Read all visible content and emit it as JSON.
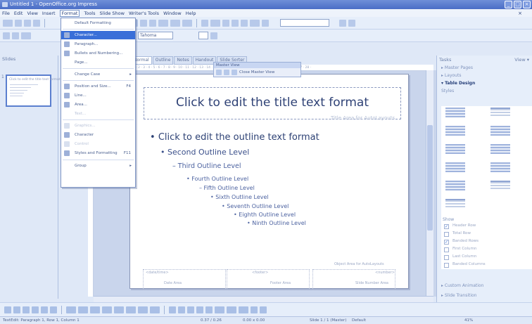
{
  "window": {
    "title": "Untitled 1 - OpenOffice.org Impress",
    "controls": [
      "_",
      "□",
      "×"
    ]
  },
  "menubar": {
    "items": [
      "File",
      "Edit",
      "View",
      "Insert",
      "Format",
      "Tools",
      "Slide Show",
      "Writer's Tools",
      "Window",
      "Help"
    ],
    "close_doc": "×"
  },
  "format_menu": {
    "items": [
      {
        "label": "Default Formatting",
        "shortcut": "",
        "state": "normal"
      },
      {
        "label": "Character...",
        "shortcut": "",
        "state": "highlighted"
      },
      {
        "label": "Paragraph...",
        "shortcut": "",
        "state": "normal"
      },
      {
        "label": "Bullets and Numbering...",
        "shortcut": "",
        "state": "normal"
      },
      {
        "label": "Page...",
        "shortcut": "",
        "state": "normal"
      },
      {
        "label": "Change Case",
        "shortcut": "",
        "state": "submenu"
      },
      {
        "label": "Position and Size...",
        "shortcut": "F4",
        "state": "normal"
      },
      {
        "label": "Line...",
        "shortcut": "",
        "state": "normal"
      },
      {
        "label": "Area...",
        "shortcut": "",
        "state": "normal"
      },
      {
        "label": "Text...",
        "shortcut": "",
        "state": "disabled"
      },
      {
        "label": "Graphics...",
        "shortcut": "",
        "state": "disabled"
      },
      {
        "label": "Character",
        "shortcut": "",
        "state": "normal"
      },
      {
        "label": "Control",
        "shortcut": "",
        "state": "disabled"
      },
      {
        "label": "Styles and Formatting",
        "shortcut": "F11",
        "state": "normal"
      },
      {
        "label": "Group",
        "shortcut": "",
        "state": "submenu"
      }
    ]
  },
  "formatting_bar": {
    "font_name": "Tahoma",
    "font_size": "",
    "style": ""
  },
  "slides_panel": {
    "header": "Slides",
    "thumb_number": "1",
    "thumb_title": "Click to edit the title text format"
  },
  "view_tabs": [
    "Normal",
    "Outline",
    "Notes",
    "Handout",
    "Slide Sorter"
  ],
  "master_view_toolbar": {
    "title": "Master View",
    "close_label": "Close Master View"
  },
  "ruler_ticks": "· 1 · 2 · 3 · 4 · 5 · 6 · 7 · 8 · 9 · 10 · 11 · 12 · 13 · 14 · 15 · 16 · 17 · 18 · 19 · 20 · 21 · 22 · 23 · 24 · 25 · 26 · 27 · 28 ·",
  "slide": {
    "title": "Click to edit the title text format",
    "title_area_label": "Title Area for AutoLayouts",
    "outline": [
      "Click to edit the outline text format",
      "Second Outline Level",
      "Third Outline Level",
      "Fourth Outline Level",
      "Fifth Outline Level",
      "Sixth Outline Level",
      "Seventh Outline Level",
      "Eighth Outline Level",
      "Ninth Outline Level"
    ],
    "object_area_label": "Object Area for AutoLayouts",
    "footer": {
      "date_label": "<date/time>",
      "date_area": "Date Area",
      "footer_label": "<footer>",
      "footer_area": "Footer Area",
      "number_label": "<number>",
      "number_area": "Slide Number Area"
    }
  },
  "tasks_panel": {
    "header": "Tasks",
    "view_menu": "View ▾",
    "sections": [
      {
        "label": "Master Pages",
        "open": false
      },
      {
        "label": "Layouts",
        "open": false
      },
      {
        "label": "Table Design",
        "open": true
      }
    ],
    "design_subhead": "Styles",
    "options_head": "Show",
    "options": [
      {
        "label": "Header Row",
        "checked": true
      },
      {
        "label": "Total Row",
        "checked": false
      },
      {
        "label": "Banded Rows",
        "checked": true
      },
      {
        "label": "First Column",
        "checked": false
      },
      {
        "label": "Last Column",
        "checked": false
      },
      {
        "label": "Banded Columns",
        "checked": false
      }
    ],
    "bottom_sections": [
      "Custom Animation",
      "Slide Transition"
    ]
  },
  "statusbar": {
    "left_text": "TextEdit: Paragraph 1, Row 1, Column 1",
    "position": "0.37 / 0.26",
    "size": "0.00 x 0.00",
    "slide": "Slide 1 / 1 (Master)",
    "layout": "Default",
    "zoom": "41%"
  },
  "colors": {
    "title_bar": "#5a7ccf",
    "highlight": "#3a6fd8",
    "slide_text": "#2f4276"
  }
}
